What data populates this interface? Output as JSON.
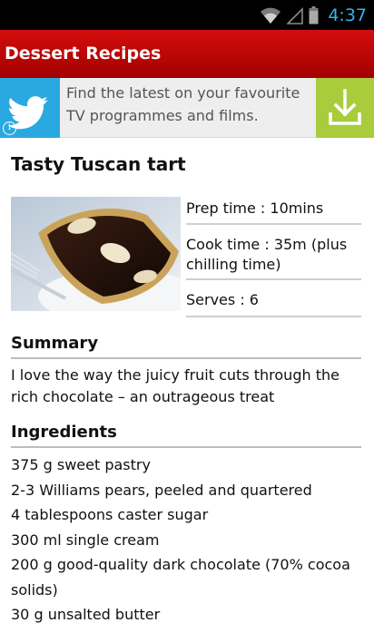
{
  "status_bar": {
    "time": "4:37",
    "icons": [
      "wifi-icon",
      "signal-icon",
      "battery-icon"
    ],
    "time_color": "#33b5e5"
  },
  "app_bar": {
    "title": "Dessert Recipes",
    "color": "#c60808"
  },
  "ad_banner": {
    "logo_icon": "twitter-bird-icon",
    "text": "Find the latest on your favourite TV programmes and films.",
    "info_icon": "info-icon",
    "action_icon": "download-icon",
    "logo_color": "#2aa9e0",
    "action_color": "#a8cc3c"
  },
  "recipe": {
    "title": "Tasty Tuscan tart",
    "prep_time": "Prep time : 10mins",
    "cook_time": "Cook time : 35m (plus chilling time)",
    "serves": "Serves : 6",
    "summary_heading": "Summary",
    "summary": "I love the way the juicy fruit cuts through the rich chocolate – an outrageous treat",
    "ingredients_heading": "Ingredients",
    "ingredients": [
      "375 g sweet pastry",
      "2-3 Williams pears, peeled and quartered",
      "4 tablespoons caster sugar",
      "300 ml single cream",
      "200 g good-quality dark chocolate (70% cocoa solids)",
      "30 g unsalted butter"
    ]
  }
}
